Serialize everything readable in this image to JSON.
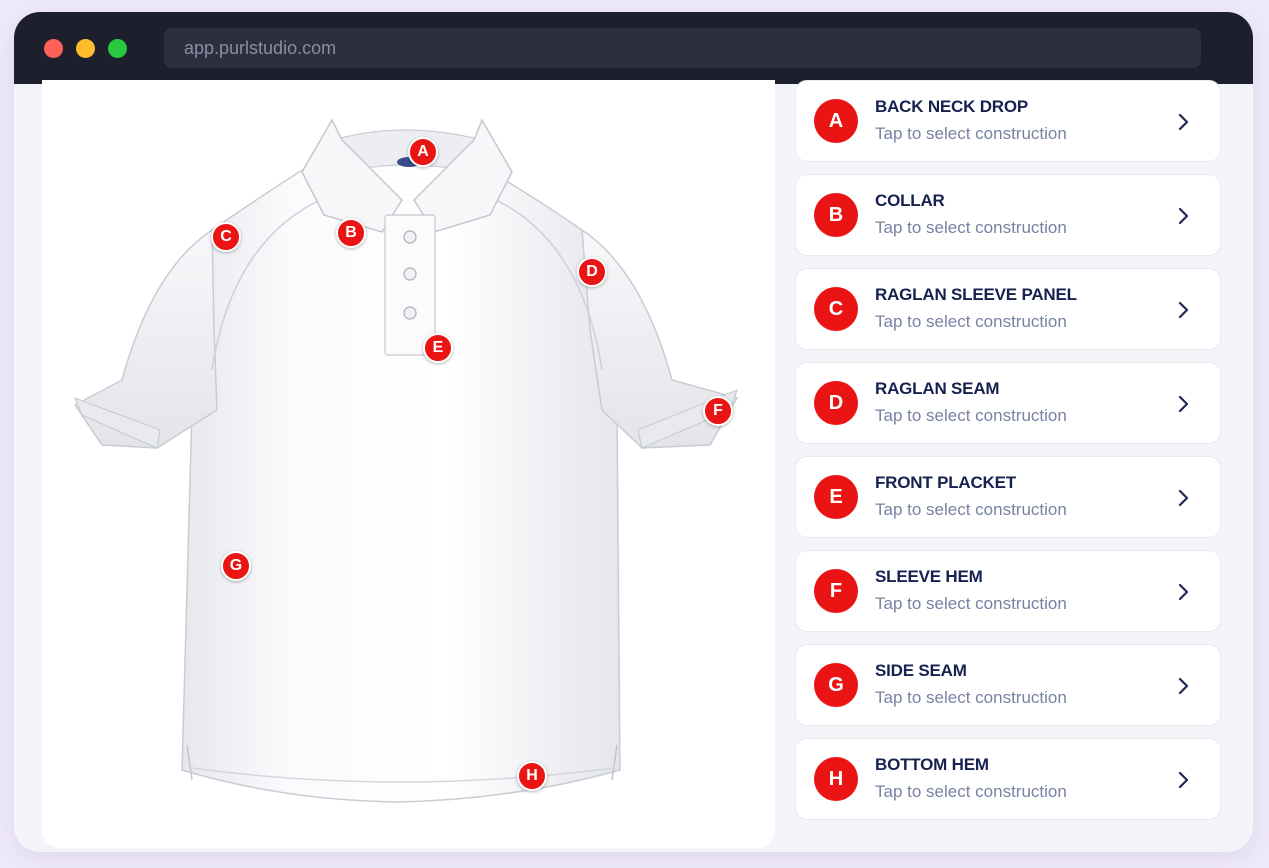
{
  "browser": {
    "url": "app.purlstudio.com"
  },
  "hotspots": [
    {
      "letter": "A"
    },
    {
      "letter": "B"
    },
    {
      "letter": "C"
    },
    {
      "letter": "D"
    },
    {
      "letter": "E"
    },
    {
      "letter": "F"
    },
    {
      "letter": "G"
    },
    {
      "letter": "H"
    }
  ],
  "zones": [
    {
      "letter": "A",
      "title": "BACK NECK DROP",
      "subtitle": "Tap to select construction"
    },
    {
      "letter": "B",
      "title": "COLLAR",
      "subtitle": "Tap to select construction"
    },
    {
      "letter": "C",
      "title": "RAGLAN SLEEVE PANEL",
      "subtitle": "Tap to select construction"
    },
    {
      "letter": "D",
      "title": "RAGLAN SEAM",
      "subtitle": "Tap to select construction"
    },
    {
      "letter": "E",
      "title": "FRONT PLACKET",
      "subtitle": "Tap to select construction"
    },
    {
      "letter": "F",
      "title": "SLEEVE HEM",
      "subtitle": "Tap to select construction"
    },
    {
      "letter": "G",
      "title": "SIDE SEAM",
      "subtitle": "Tap to select construction"
    },
    {
      "letter": "H",
      "title": "BOTTOM HEM",
      "subtitle": "Tap to select construction"
    }
  ],
  "colors": {
    "accent": "#ea1414",
    "title_text": "#16214f",
    "subtitle_text": "#7882a3",
    "chrome": "#1d1f2c"
  },
  "icons": {
    "row_action": "chevron-right-icon",
    "window_controls": [
      "close-dot",
      "minimize-dot",
      "maximize-dot"
    ]
  }
}
